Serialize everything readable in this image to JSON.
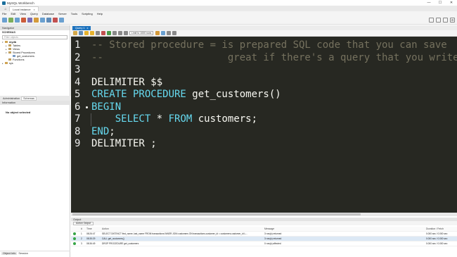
{
  "window": {
    "title": "MySQL Workbench",
    "controls": [
      "—",
      "☐",
      "✕"
    ]
  },
  "connection_tab": {
    "label": "Local instance",
    "close": "x"
  },
  "menu": [
    "File",
    "Edit",
    "View",
    "Query",
    "Database",
    "Server",
    "Tools",
    "Scripting",
    "Help"
  ],
  "toolbar_colors": [
    "#6aa0d0",
    "#7cae5a",
    "#6aa0d0",
    "#cc5b3a",
    "#7a6fb5",
    "#d49a3a",
    "#6aa0d0",
    "#5f8bb8",
    "#c25050",
    "#6aa0d0"
  ],
  "sidebar": {
    "navigator_label": "Navigator",
    "schemas_label": "SCHEMAS",
    "filter_placeholder": "Filter objects",
    "tree": [
      {
        "twisty": "▾",
        "label": "mydb",
        "bold": true,
        "indent": 3,
        "icon_color": "#cfa454"
      },
      {
        "twisty": "▸",
        "label": "Tables",
        "bold": false,
        "indent": 8,
        "icon_color": "#c0a060"
      },
      {
        "twisty": "▸",
        "label": "Views",
        "bold": false,
        "indent": 8,
        "icon_color": "#c0a060"
      },
      {
        "twisty": "▾",
        "label": "Stored Procedures",
        "bold": false,
        "indent": 8,
        "icon_color": "#c0a060"
      },
      {
        "twisty": "",
        "label": "get_customers",
        "bold": false,
        "indent": 14,
        "icon_color": "#7a9bc4"
      },
      {
        "twisty": "",
        "label": "Functions",
        "bold": false,
        "indent": 8,
        "icon_color": "#c0a060"
      },
      {
        "twisty": "▸",
        "label": "sys",
        "bold": false,
        "indent": 3,
        "icon_color": "#cfa454"
      }
    ],
    "tabs": {
      "administration": "Administration",
      "schemas": "Schemas"
    },
    "information_label": "Information",
    "no_object": "No object selected",
    "bottom_tabs": {
      "object_info": "Object Info",
      "session": "Session"
    }
  },
  "query_tab": {
    "label": "Query 1",
    "close": "x"
  },
  "query_toolbar": {
    "limit": "Limit to 1000 rows"
  },
  "editor": {
    "lines": [
      {
        "n": "1",
        "segments": [
          {
            "cls": "cmt",
            "text": "-- Stored procedure = is prepared SQL code that you can save"
          }
        ]
      },
      {
        "n": "2",
        "segments": [
          {
            "cls": "cmt",
            "text": "--                     great if there's a query that you write often"
          }
        ]
      },
      {
        "n": "3",
        "segments": []
      },
      {
        "n": "4",
        "segments": [
          {
            "cls": "",
            "text": "DELIMITER $$"
          }
        ]
      },
      {
        "n": "5",
        "segments": [
          {
            "cls": "kw",
            "text": "CREATE PROCEDURE"
          },
          {
            "cls": "",
            "text": " get_customers()"
          }
        ]
      },
      {
        "n": "6",
        "segments": [
          {
            "cls": "kw",
            "text": "BEGIN"
          }
        ]
      },
      {
        "n": "7",
        "segments": [
          {
            "cls": "",
            "text": "    "
          },
          {
            "cls": "kw",
            "text": "SELECT"
          },
          {
            "cls": "",
            "text": " * "
          },
          {
            "cls": "kw",
            "text": "FROM"
          },
          {
            "cls": "",
            "text": " customers;"
          }
        ]
      },
      {
        "n": "8",
        "segments": [
          {
            "cls": "kw",
            "text": "END"
          },
          {
            "cls": "",
            "text": ";"
          }
        ]
      },
      {
        "n": "9",
        "segments": [
          {
            "cls": "",
            "text": "DELIMITER ;"
          }
        ]
      }
    ]
  },
  "output": {
    "header": "Output",
    "selector": "Action Output",
    "columns": {
      "num": "#",
      "time": "Time",
      "action": "Action",
      "message": "Message",
      "duration": "Duration / Fetch"
    },
    "rows": [
      {
        "num": "1",
        "time": "08:26:47",
        "action": "SELECT DISTINCT first_name, last_name FROM transactions INNER JOIN customers ON transactions.customer_id = customers.customer_id L...",
        "message": "3 row(s) returned",
        "duration": "0.000 sec / 0.000 sec"
      },
      {
        "num": "2",
        "time": "08:35:29",
        "action": "CALL get_customers()",
        "message": "3 row(s) returned",
        "duration": "0.000 sec / 0.000 sec"
      },
      {
        "num": "3",
        "time": "08:36:49",
        "action": "DROP PROCEDURE get_customers",
        "message": "0 row(s) affected",
        "duration": "0.000 sec / 0.000 sec"
      }
    ]
  }
}
